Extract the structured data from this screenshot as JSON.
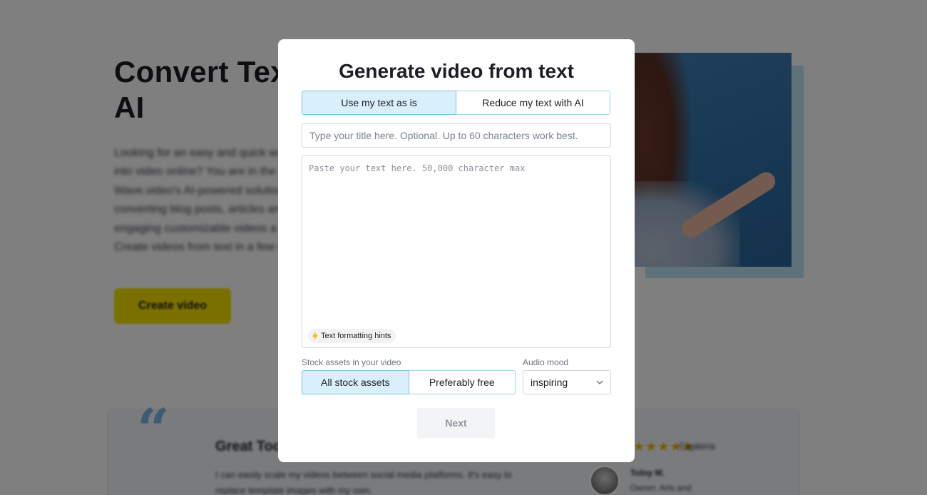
{
  "background": {
    "hero": {
      "title": "Convert Text to Video with AI",
      "description": "Looking for an easy and quick way to turn text into video online? You are in the right place. Wave.video's AI-powered solution makes converting blog posts, articles and more into engaging customizable videos a breeze. Create videos from text in a few clicks.",
      "cta_label": "Create video"
    },
    "review": {
      "quote_glyph": "“",
      "title": "Great Tool",
      "text": "I can easily scale my videos between social media platforms. It's easy to replace template images with my own.",
      "stars": "★★★★★",
      "source": "Capterra",
      "reviewer_name": "Tolny M.",
      "reviewer_role": "Owner, Arts and"
    }
  },
  "modal": {
    "title": "Generate video from text",
    "mode_tabs": [
      {
        "label": "Use my text as is",
        "active": true
      },
      {
        "label": "Reduce my text with AI",
        "active": false
      }
    ],
    "title_input": {
      "value": "",
      "placeholder": "Type your title here. Optional. Up to 60 characters work best."
    },
    "text_input": {
      "value": "",
      "placeholder": "Paste your text here. 50,000 character max"
    },
    "hints_label": "Text formatting hints",
    "stock_assets": {
      "label": "Stock assets in your video",
      "options": [
        {
          "label": "All stock assets",
          "active": true
        },
        {
          "label": "Preferably free",
          "active": false
        }
      ]
    },
    "audio_mood": {
      "label": "Audio mood",
      "selected": "inspiring"
    },
    "next_label": "Next"
  },
  "colors": {
    "accent_bg": "#d9effb",
    "accent_border": "#7dc1e6",
    "cta_yellow": "#f5e000",
    "hint_bolt": "#f5b800"
  },
  "icons": {
    "hints": "lightning-bolt-icon",
    "audio_select": "chevron-down-icon",
    "review_quote": "quote-icon",
    "reviewer": "avatar"
  }
}
